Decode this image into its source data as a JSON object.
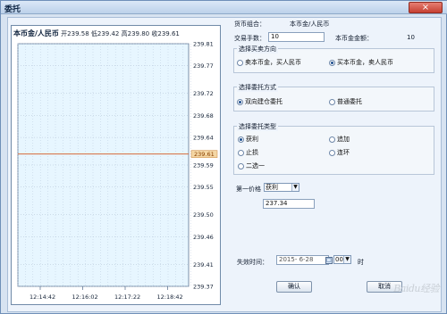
{
  "window": {
    "title": "委托",
    "close_icon": "close-icon"
  },
  "chart": {
    "name": "本币金/人民币",
    "open": "开239.58",
    "low": "低239.42",
    "high": "高239.80",
    "close": "收239.61",
    "y_labels": [
      "239.81",
      "239.77",
      "239.72",
      "239.68",
      "239.64",
      "239.61",
      "239.59",
      "239.55",
      "239.50",
      "239.46",
      "239.41",
      "239.37"
    ],
    "x_labels": [
      "12:14:42",
      "12:16:02",
      "12:17:22",
      "12:18:42"
    ],
    "current_price": "239.61"
  },
  "chart_data": {
    "type": "line",
    "title": "",
    "xlabel": "",
    "ylabel": "",
    "x": [
      "12:14:42",
      "12:16:02",
      "12:17:22",
      "12:18:42"
    ],
    "series": [
      {
        "values": [
          239.61,
          239.61,
          239.61,
          239.61
        ]
      }
    ],
    "ylim": [
      239.37,
      239.81
    ],
    "grid": true
  },
  "form": {
    "currency_label": "货币组合：",
    "currency_value": "本币金/人民币",
    "quantity_label": "交易手数：",
    "quantity_value": "10",
    "total_label": "本币金金额：",
    "total_value": "10",
    "direction_title": "选择买卖方向",
    "direction_options": [
      "卖本币金，买人民币",
      "买本币金，卖人民币"
    ],
    "method_title": "选择委托方式",
    "method_options": [
      "双向建仓委托",
      "普通委托"
    ],
    "type_title": "选择委托类型",
    "type_options": [
      "获利",
      "追加",
      "止损",
      "连环",
      "二选一"
    ],
    "price1_label": "第一价格",
    "price1_type": "获利",
    "price1_value": "237.34",
    "expiry_label": "失效时间：",
    "expiry_date": "2015- 6-28",
    "expiry_hour": "00",
    "expiry_unit": "时",
    "ok_label": "确认",
    "cancel_label": "取消"
  },
  "watermark": "Baidu经验"
}
